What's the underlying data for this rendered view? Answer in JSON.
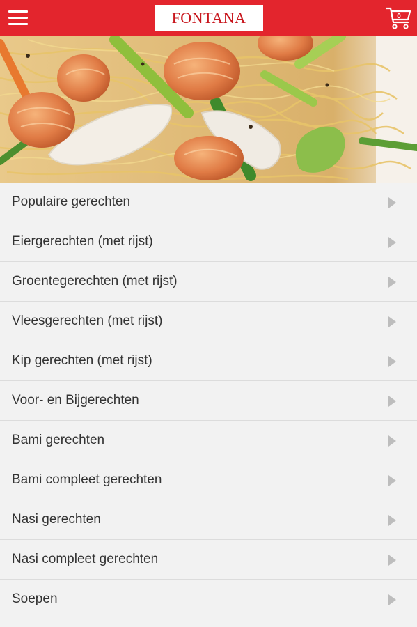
{
  "header": {
    "logo_text": "FONTANA",
    "cart_count": "0",
    "brand_color": "#e3252d",
    "icons": [
      "hamburger-menu-icon",
      "shopping-cart-icon"
    ]
  },
  "hero": {
    "image": "stir-fried noodles with shrimp and vegetables"
  },
  "menu": {
    "items": [
      {
        "label": "Populaire gerechten"
      },
      {
        "label": "Eiergerechten (met rijst)"
      },
      {
        "label": "Groentegerechten (met rijst)"
      },
      {
        "label": "Vleesgerechten (met rijst)"
      },
      {
        "label": "Kip gerechten (met rijst)"
      },
      {
        "label": "Voor- en Bijgerechten"
      },
      {
        "label": "Bami gerechten"
      },
      {
        "label": "Bami compleet gerechten"
      },
      {
        "label": "Nasi gerechten"
      },
      {
        "label": "Nasi compleet gerechten"
      },
      {
        "label": "Soepen"
      }
    ],
    "item_icon": "chevron-right-icon"
  }
}
